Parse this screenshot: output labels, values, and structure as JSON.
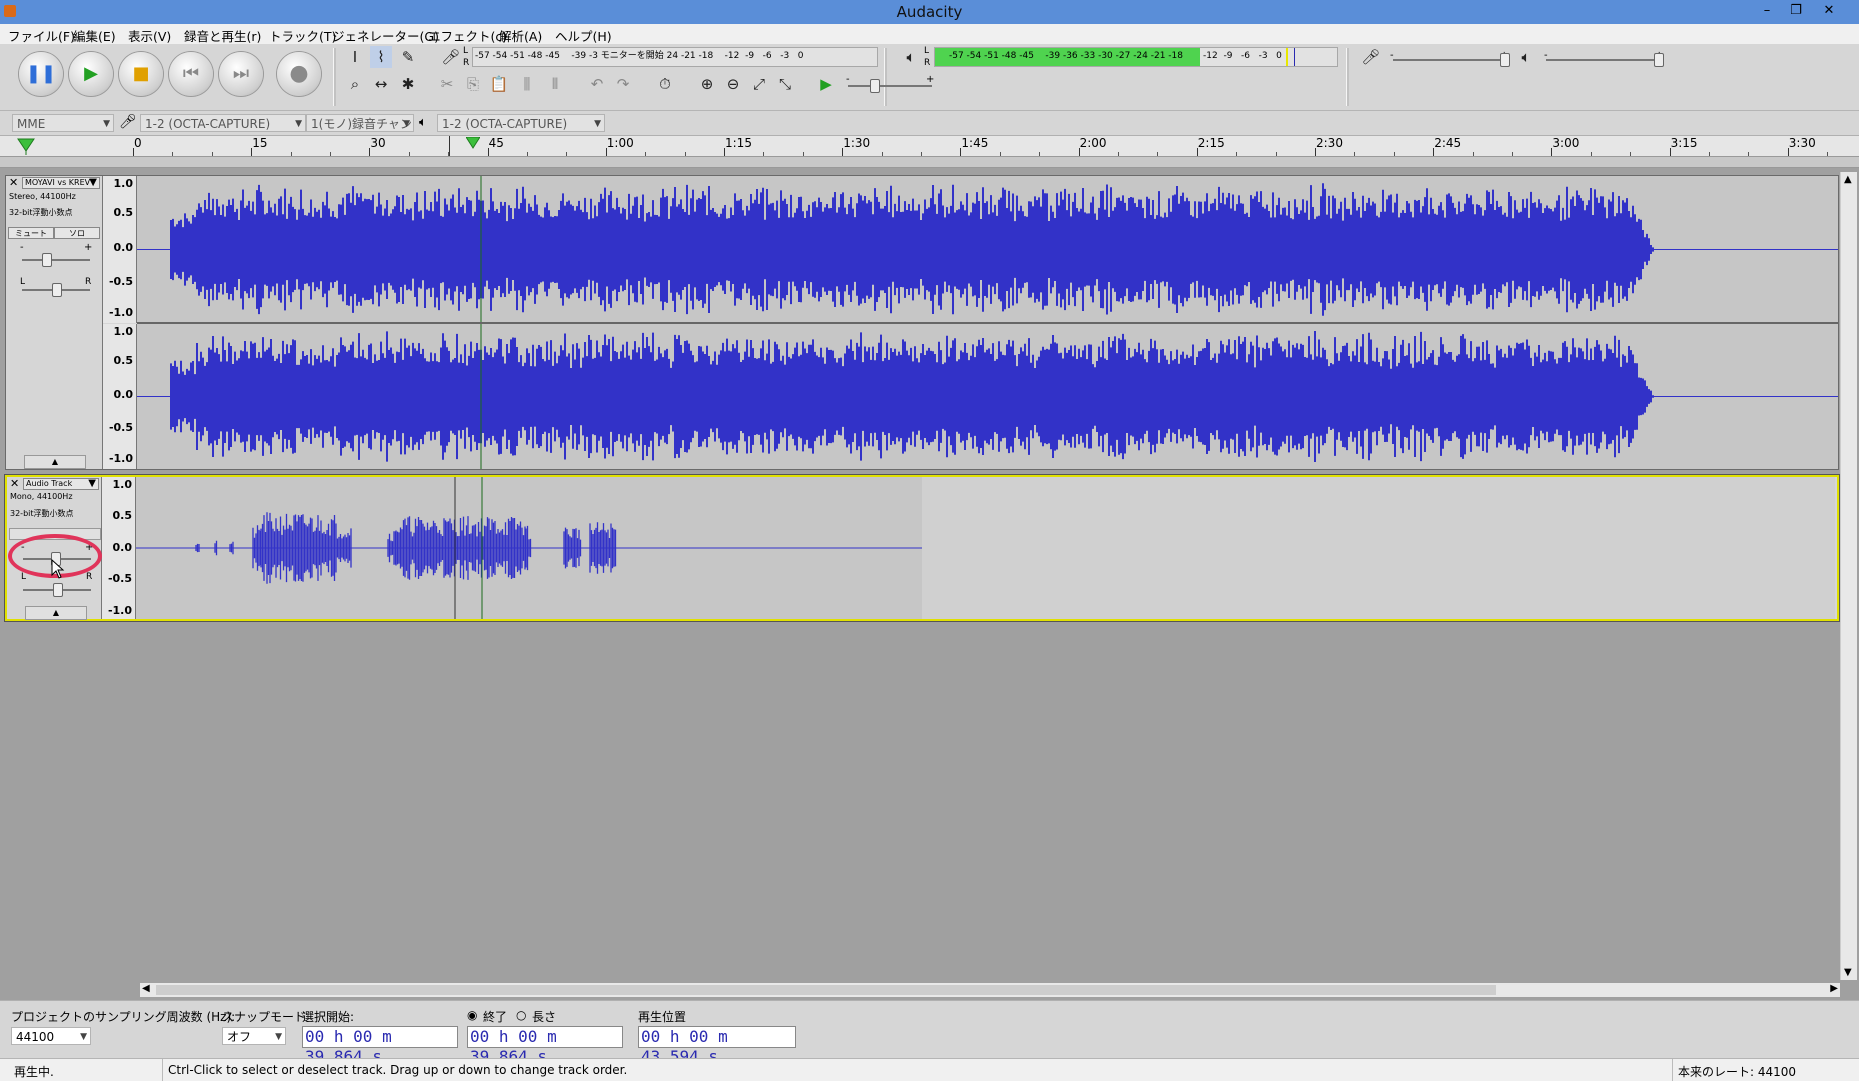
{
  "window": {
    "title": "Audacity",
    "minimize": "–",
    "restore": "❐",
    "close": "✕"
  },
  "menu": [
    "ファイル(F)",
    "編集(E)",
    "表示(V)",
    "録音と再生(r)",
    "トラック(T)",
    "ジェネレーター(G)",
    "エフェクト(c)",
    "解析(A)",
    "ヘルプ(H)"
  ],
  "transport": {
    "pause": "❚❚",
    "play": "▶",
    "stop": "■",
    "skip_start": "⏮",
    "skip_end": "⏭",
    "record": "●"
  },
  "tools": {
    "select": "I",
    "envelope": "⌇",
    "draw": "✎",
    "zoom": "⌕",
    "timeshift": "↔",
    "multi": "✱"
  },
  "edit_tools": {
    "cut": "✂",
    "copy": "⎘",
    "paste": "📋",
    "trim": "⫼",
    "silence": "⫴",
    "undo": "↶",
    "redo": "↷",
    "sync": "⏱",
    "zoom_in": "⊕",
    "zoom_out": "⊖",
    "fit_sel": "⤢",
    "fit_proj": "⤡",
    "play_at_speed": "▶"
  },
  "meters": {
    "rec_l": "L",
    "rec_r": "R",
    "rec_scale": "-57 -54 -51 -48 -45    -39 -3 モニターを開始 24 -21 -18    -12  -9   -6   -3   0",
    "play_l": "L",
    "play_r": "R",
    "play_scale": "-57 -54 -51 -48 -45    -39 -36 -33 -30 -27 -24 -21 -18       -12  -9   -6   -3   0",
    "play_level": 0.66,
    "accent": "#4fd34f",
    "minus": "-",
    "plus": "+"
  },
  "devices": {
    "host": "MME",
    "rec_device": "1-2 (OCTA-CAPTURE)",
    "channels": "1(モノ)録音チャン",
    "play_device": "1-2 (OCTA-CAPTURE)"
  },
  "ruler": [
    "0",
    "15",
    "30",
    "45",
    "1:00",
    "1:15",
    "1:30",
    "1:45",
    "2:00",
    "2:15",
    "2:30",
    "2:45",
    "3:00",
    "3:15",
    "3:30"
  ],
  "tracks": [
    {
      "name": "MOYAVI vs KREV",
      "info1": "Stereo, 44100Hz",
      "info2": "32-bit浮動小数点",
      "mute": "ミュート",
      "solo": "ソロ",
      "gain_l": "-",
      "gain_r": "+",
      "pan_l": "L",
      "pan_r": "R",
      "scale": [
        "1.0",
        "0.5",
        "0.0",
        "-0.5",
        "-1.0"
      ],
      "wave_color": "#3232c8"
    },
    {
      "name": "Audio Track",
      "info1": "Mono, 44100Hz",
      "info2": "32-bit浮動小数点",
      "gain_l": "-",
      "gain_r": "+",
      "pan_l": "L",
      "pan_r": "R",
      "scale": [
        "1.0",
        "0.5",
        "0.0",
        "-0.5",
        "-1.0"
      ],
      "highlight": "#e0345a"
    }
  ],
  "selection": {
    "rate_label": "プロジェクトのサンプリング周波数 (Hz):",
    "rate_value": "44100",
    "snap_label": "スナップモード",
    "snap_value": "オフ",
    "start_label": "選択開始:",
    "start_value": "00 h 00 m 39.864 s",
    "end_label": "終了",
    "length_label": "長さ",
    "end_value": "00 h 00 m 39.864 s",
    "pos_label": "再生位置",
    "pos_value": "00 h 00 m 43.594 s"
  },
  "status": {
    "state": "再生中.",
    "hint": "Ctrl-Click to select or deselect track. Drag up or down to change track order.",
    "rate": "本来のレート: 44100"
  }
}
